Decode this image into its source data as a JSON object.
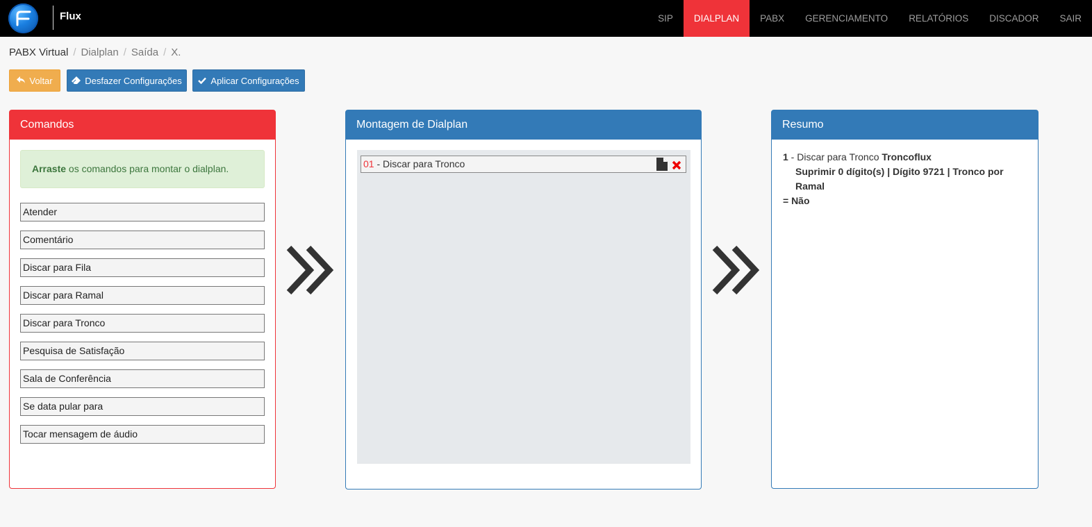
{
  "header": {
    "brand": "Flux",
    "nav": [
      {
        "label": "SIP",
        "active": false
      },
      {
        "label": "DIALPLAN",
        "active": true
      },
      {
        "label": "PABX",
        "active": false
      },
      {
        "label": "GERENCIAMENTO",
        "active": false
      },
      {
        "label": "RELATÓRIOS",
        "active": false
      },
      {
        "label": "DISCADOR",
        "active": false
      },
      {
        "label": "SAIR",
        "active": false
      }
    ]
  },
  "breadcrumb": [
    "PABX Virtual",
    "Dialplan",
    "Saída",
    "X."
  ],
  "toolbar": {
    "back_label": "Voltar",
    "undo_label": "Desfazer Configurações",
    "apply_label": "Aplicar Configurações"
  },
  "commands_panel": {
    "title": "Comandos",
    "hint_bold": "Arraste",
    "hint_rest": " os comandos para montar o dialplan.",
    "items": [
      "Atender",
      "Comentário",
      "Discar para Fila",
      "Discar para Ramal",
      "Discar para Tronco",
      "Pesquisa de Satisfação",
      "Sala de Conferência",
      "Se data pular para",
      "Tocar mensagem de áudio"
    ]
  },
  "assembly_panel": {
    "title": "Montagem de Dialplan",
    "steps": [
      {
        "number": "01",
        "label": " - Discar para Tronco"
      }
    ]
  },
  "summary_panel": {
    "title": "Resumo",
    "entries": [
      {
        "index": "1",
        "prefix": " - Discar para Tronco ",
        "target": "Troncoflux",
        "detail": "Suprimir 0 dígito(s) | Dígito 9721 | Tronco por Ramal",
        "detail_tail": "= Não"
      }
    ]
  },
  "colors": {
    "accent_red": "#ef3339",
    "primary_blue": "#337ab7",
    "warning_orange": "#f0ad4e"
  }
}
